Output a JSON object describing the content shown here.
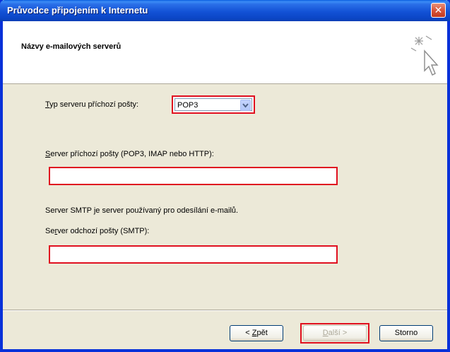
{
  "window": {
    "title": "Průvodce připojením k Internetu",
    "close_label": "✕"
  },
  "header": {
    "title": "Názvy e-mailových serverů",
    "icon": "cursor-sparkle-icon"
  },
  "form": {
    "server_type_label_u": "T",
    "server_type_label_rest": "yp serveru příchozí pošty:",
    "server_type_value": "POP3",
    "incoming_label_u": "S",
    "incoming_label_rest": "erver příchozí pošty (POP3, IMAP nebo HTTP):",
    "incoming_value": "",
    "smtp_info": "Server SMTP je server používaný pro odesílání e-mailů.",
    "outgoing_label_pre": "Se",
    "outgoing_label_u": "r",
    "outgoing_label_rest": "ver odchozí pošty (SMTP):",
    "outgoing_value": ""
  },
  "buttons": {
    "back_pre": "< ",
    "back_u": "Z",
    "back_rest": "pět",
    "next_u": "D",
    "next_rest": "alší >",
    "cancel": "Storno"
  },
  "colors": {
    "highlight": "#e01020",
    "title_bar": "#0a46c6",
    "dialog_bg": "#ece9d8"
  }
}
